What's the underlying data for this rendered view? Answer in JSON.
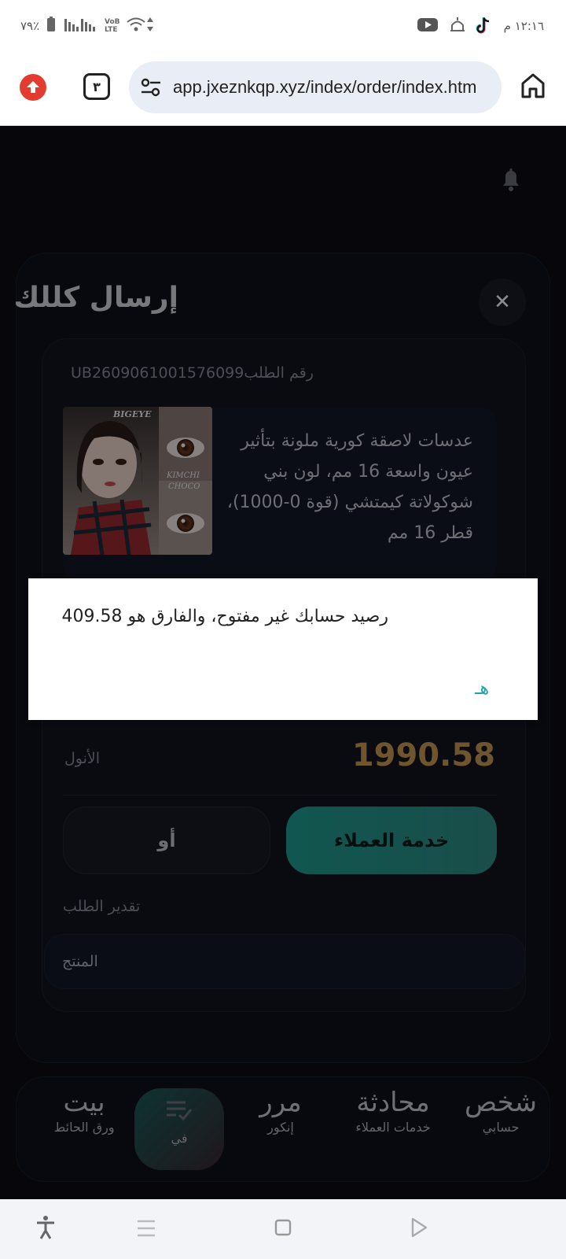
{
  "status_bar": {
    "time": "١٢:١٦ م",
    "battery": "٧٩٪"
  },
  "browser": {
    "url": "app.jxeznkqp.xyz/index/order/index.htm",
    "tab_count": "٣"
  },
  "sheet": {
    "title": "إرسال كللك",
    "order_number": "رقم الطلبUB2609061001576099",
    "product_description": "عدسات لاصقة كورية ملونة بتأثير عيون واسعة 16 مم، لون بني شوكولاتة كيمتشي (قوة 0-1000)، قطر 16 مم",
    "product_image_text": {
      "top": "BIGEYE",
      "side_line1": "KIMCHI",
      "side_line2": "CHOCO"
    },
    "amount_label": "الأنول",
    "amount_value": "1990.58",
    "secondary_button": "أو",
    "primary_button": "خدمة العملاء",
    "rating_label": "تقدير الطلب",
    "product_input_placeholder": "المنتج"
  },
  "alert": {
    "message": "رصيد حسابك غير مفتوح، والفارق هو 409.58",
    "ok_label": "هـ"
  },
  "bottom_nav": {
    "items": [
      {
        "big": "بيت",
        "small": "ورق الحائط"
      },
      {
        "big": "",
        "small": "في"
      },
      {
        "big": "مرر",
        "small": "إنكور"
      },
      {
        "big": "محادثة",
        "small": "خدمات العملاء"
      },
      {
        "big": "شخص",
        "small": "حسابي"
      }
    ]
  },
  "colors": {
    "accent_teal": "#1f9e93",
    "amount_gold": "#c99c55",
    "alert_button": "#1aa3b0"
  }
}
